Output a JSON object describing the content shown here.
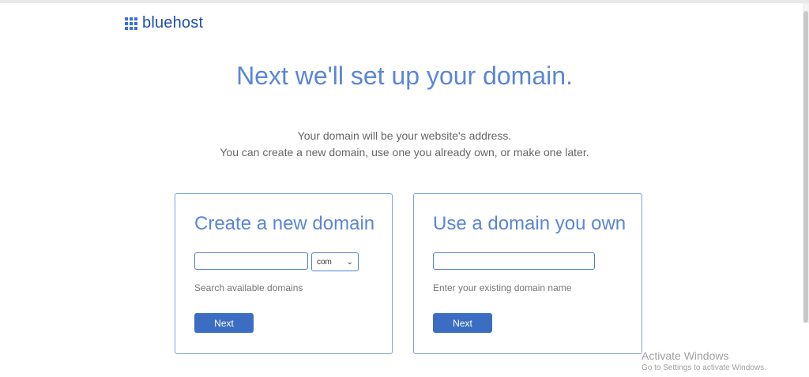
{
  "brand": {
    "name": "bluehost",
    "accent": "#3a6fd8"
  },
  "headline": "Next we'll set up your domain.",
  "subtext": {
    "line1": "Your domain will be your website's address.",
    "line2": "You can create a new domain, use one you already own, or make one later."
  },
  "create_card": {
    "title": "Create a new domain",
    "input_value": "",
    "tld_selected": "com",
    "hint": "Search available domains",
    "button_label": "Next"
  },
  "own_card": {
    "title": "Use a domain you own",
    "input_value": "",
    "hint": "Enter your existing domain name",
    "button_label": "Next"
  },
  "watermark": {
    "title": "Activate Windows",
    "subtitle": "Go to Settings to activate Windows."
  }
}
